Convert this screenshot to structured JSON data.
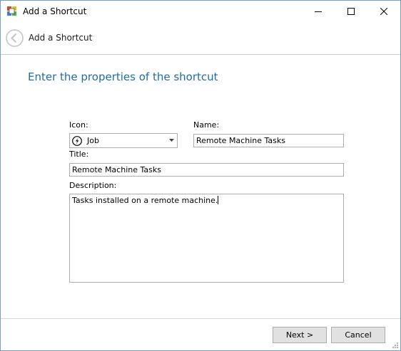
{
  "window": {
    "title": "Add a Shortcut",
    "icons": [
      "app-icon",
      "minimize-icon",
      "maximize-icon",
      "close-icon"
    ]
  },
  "nav": {
    "title": "Add a Shortcut",
    "back_icon": "back-arrow-icon"
  },
  "form": {
    "heading": "Enter the properties of the shortcut",
    "icon_label": "Icon:",
    "icon_value": "Job",
    "name_label": "Name:",
    "name_value": "Remote Machine Tasks",
    "title_label": "Title:",
    "title_value": "Remote Machine Tasks",
    "description_label": "Description:",
    "description_value": "Tasks installed on a remote machine."
  },
  "footer": {
    "next_label": "Next >",
    "cancel_label": "Cancel"
  },
  "colors": {
    "heading": "#1f6ca7",
    "border": "#abadb3",
    "button_bg": "#e1e1e1"
  }
}
